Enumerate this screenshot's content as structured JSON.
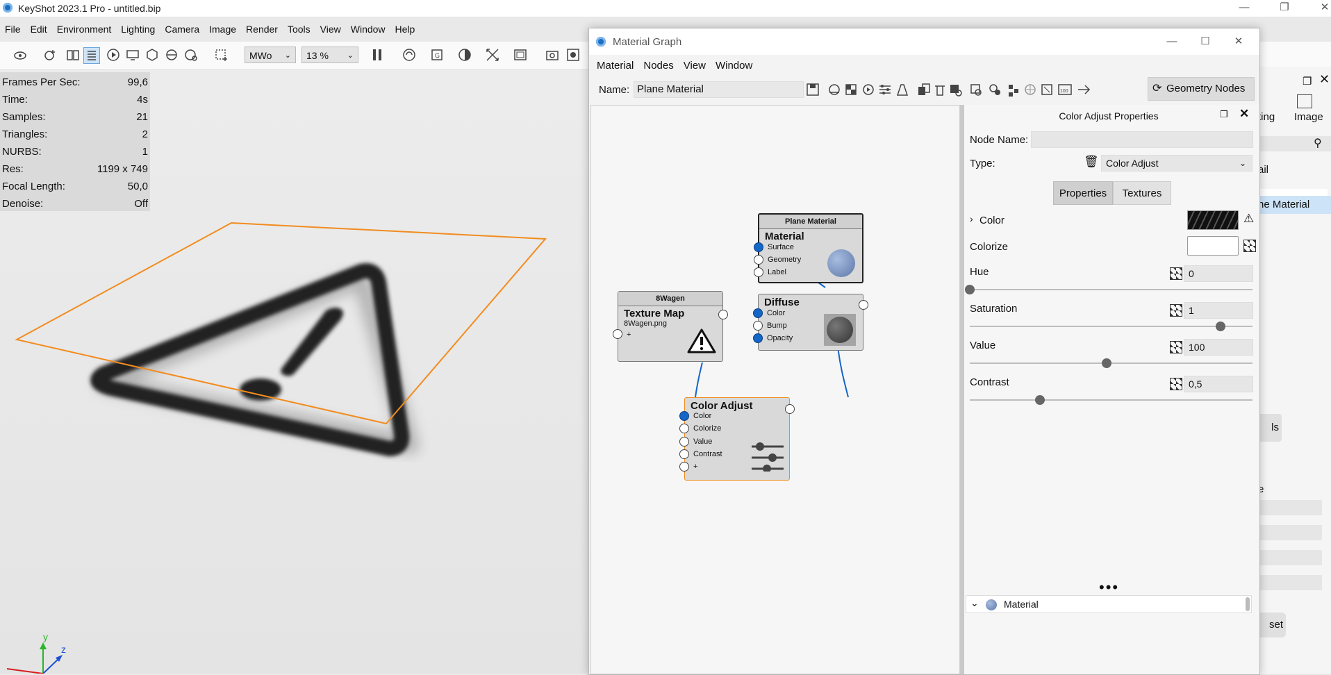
{
  "app": {
    "title": "KeyShot 2023.1 Pro  -  untitled.bip",
    "menu": [
      "File",
      "Edit",
      "Environment",
      "Lighting",
      "Camera",
      "Image",
      "Render",
      "Tools",
      "View",
      "Window",
      "Help"
    ],
    "toolbar": {
      "mode_value": "MWo",
      "zoom_value": "13 %"
    }
  },
  "hud": [
    {
      "label": "Frames Per Sec:",
      "value": "99,6"
    },
    {
      "label": "Time:",
      "value": "4s"
    },
    {
      "label": "Samples:",
      "value": "21"
    },
    {
      "label": "Triangles:",
      "value": "2"
    },
    {
      "label": "NURBS:",
      "value": "1"
    },
    {
      "label": "Res:",
      "value": "1199 x 749"
    },
    {
      "label": "Focal Length:",
      "value": "50,0"
    },
    {
      "label": "Denoise:",
      "value": "Off"
    }
  ],
  "axes": {
    "y": "y",
    "z": "z"
  },
  "side_panel": {
    "tab_partial": "ting",
    "image_tab": "Image",
    "item_partial": "ail",
    "selected_partial": "ne Material",
    "btn_partial_1": "ls",
    "btn_partial_2": "set",
    "label_partial": "e"
  },
  "material_graph": {
    "title": "Material Graph",
    "menu": [
      "Material",
      "Nodes",
      "View",
      "Window"
    ],
    "name_label": "Name:",
    "name_value": "Plane Material",
    "geometry_nodes_button": "Geometry Nodes",
    "nodes": {
      "plane_material": {
        "header": "Plane Material",
        "title": "Material",
        "ports": [
          "Surface",
          "Geometry",
          "Label"
        ]
      },
      "texture": {
        "header": "8Wagen",
        "title": "Texture Map",
        "file": "8Wagen.png",
        "plus": "+"
      },
      "diffuse": {
        "title": "Diffuse",
        "ports": [
          "Color",
          "Bump",
          "Opacity"
        ]
      },
      "color_adjust": {
        "title": "Color Adjust",
        "ports": [
          "Color",
          "Colorize",
          "Value",
          "Contrast",
          "+"
        ]
      }
    },
    "properties": {
      "header": "Color Adjust Properties",
      "node_name_label": "Node Name:",
      "node_name_value": "",
      "type_label": "Type:",
      "type_value": "Color Adjust",
      "tab_properties": "Properties",
      "tab_textures": "Textures",
      "color_label": "Color",
      "colorize_label": "Colorize",
      "hue_label": "Hue",
      "hue_value": "0",
      "saturation_label": "Saturation",
      "saturation_value": "1",
      "value_label": "Value",
      "value_value": "100",
      "contrast_label": "Contrast",
      "contrast_value": "0,5",
      "material_section": "Material"
    }
  },
  "colors": {
    "accent": "#1466c7",
    "selection": "#dcecfb",
    "outline": "#f28c1f"
  }
}
